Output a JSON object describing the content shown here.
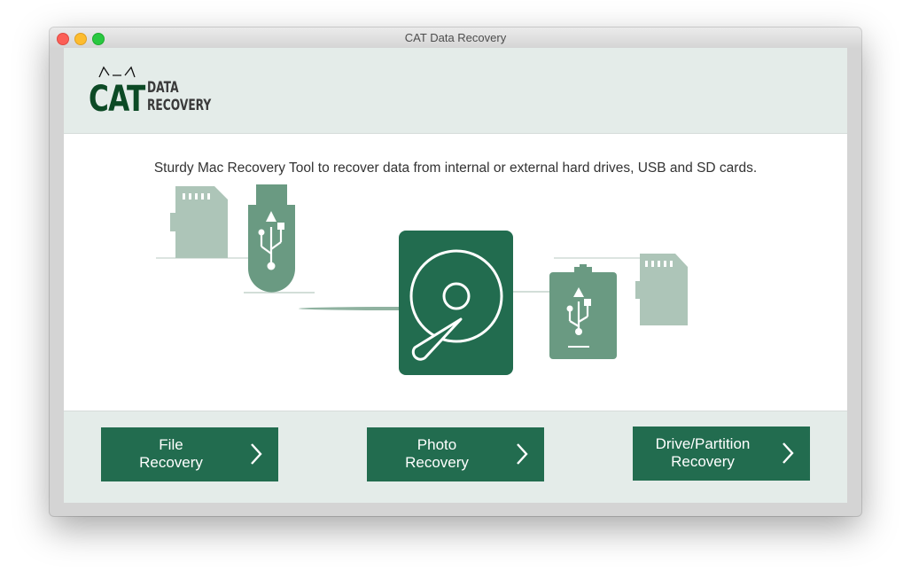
{
  "window": {
    "title": "CAT Data Recovery"
  },
  "logo": {
    "main": "CAT",
    "line1": "DATA",
    "line2": "RECOVERY"
  },
  "tagline": "Sturdy Mac Recovery Tool to recover data from internal or external hard drives, USB and SD cards.",
  "colors": {
    "primary": "#226c4f",
    "secondary": "#6a9a82",
    "light": "#adc5b8",
    "panel": "#e4ece9",
    "logo": "#0c4a25"
  },
  "illustration": {
    "icons": [
      "sd-card-icon",
      "usb-drive-icon",
      "hard-drive-icon",
      "usb-device-icon",
      "sd-card-icon"
    ]
  },
  "buttons": [
    {
      "label_line1": "File",
      "label_line2": "Recovery",
      "icon": "chevron-right-icon"
    },
    {
      "label_line1": "Photo",
      "label_line2": "Recovery",
      "icon": "chevron-right-icon"
    },
    {
      "label_line1": "Drive/Partition",
      "label_line2": "Recovery",
      "icon": "chevron-right-icon"
    }
  ]
}
